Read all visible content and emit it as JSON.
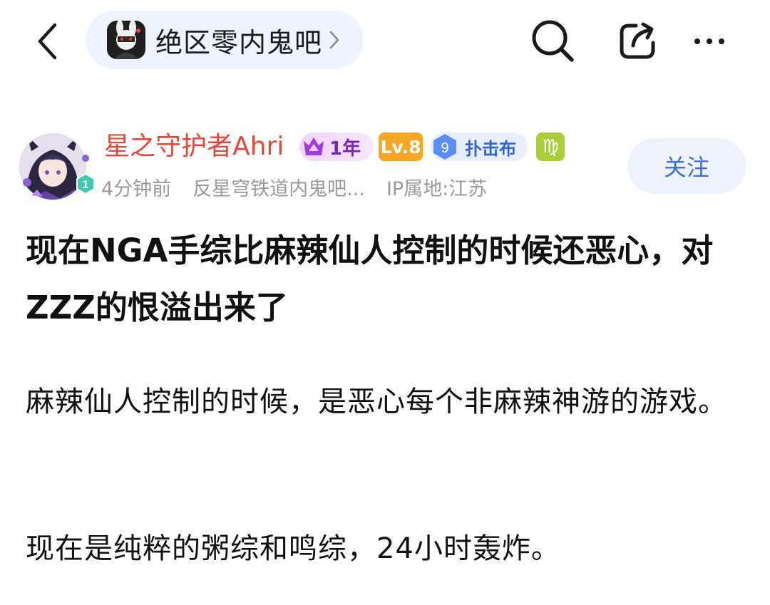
{
  "header": {
    "forum_name": "绝区零内鬼吧"
  },
  "author": {
    "username": "星之守护者Ahri",
    "avatar_level": "1",
    "badges": {
      "year": "1年",
      "level": "Lv.8",
      "fan_level": "9",
      "fan_title": "扑击布",
      "zodiac": "♍"
    },
    "time": "4分钟前",
    "source": "反星穹铁道内鬼吧...",
    "ip": "IP属地:江苏",
    "follow_label": "关注"
  },
  "post": {
    "title": "现在NGA手综比麻辣仙人控制的时候还恶心，对ZZZ的恨溢出来了",
    "paragraphs": [
      "麻辣仙人控制的时候，是恶心每个非麻辣神游的游戏。",
      "现在是纯粹的粥综和鸣综，24小时轰炸。"
    ]
  },
  "colors": {
    "username": "#e8463a",
    "follow_text": "#3d6fd8",
    "follow_bg": "#edf2fb",
    "pill_bg": "#eef3fc",
    "meta_text": "#9a9a9a"
  }
}
